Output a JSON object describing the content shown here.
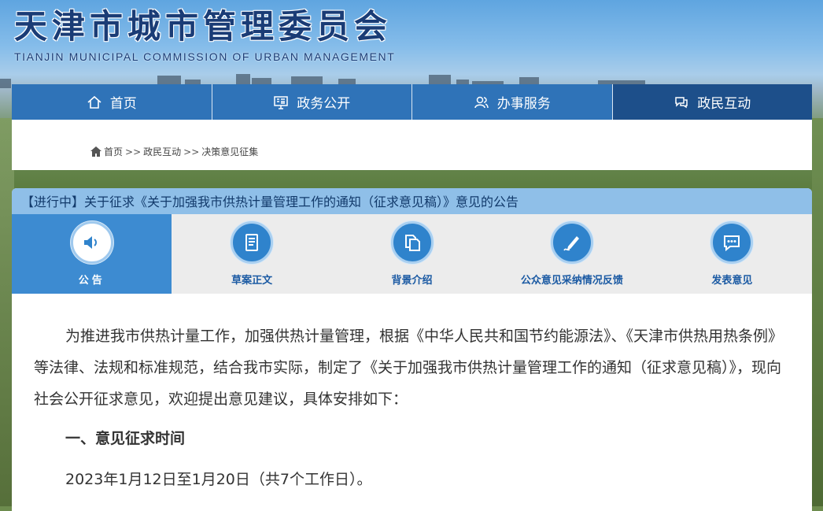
{
  "header": {
    "title": "天津市城市管理委员会",
    "subtitle": "TIANJIN MUNICIPAL COMMISSION OF URBAN MANAGEMENT"
  },
  "nav": {
    "items": [
      {
        "label": "首页",
        "icon": "home-outline-icon"
      },
      {
        "label": "政务公开",
        "icon": "monitor-doc-icon"
      },
      {
        "label": "办事服务",
        "icon": "people-icon"
      },
      {
        "label": "政民互动",
        "icon": "chat-bubbles-icon"
      }
    ]
  },
  "breadcrumb": {
    "home": "首页",
    "sep": ">>",
    "level1": "政民互动",
    "level2": "决策意见征集"
  },
  "notice": {
    "title": "【进行中】关于征求《关于加强我市供热计量管理工作的通知（征求意见稿）》意见的公告",
    "tabs": [
      {
        "label": "公告",
        "icon": "speaker-icon"
      },
      {
        "label": "草案正文",
        "icon": "document-icon"
      },
      {
        "label": "背景介绍",
        "icon": "copy-files-icon"
      },
      {
        "label": "公众意见采纳情况反馈",
        "icon": "pen-edit-icon"
      },
      {
        "label": "发表意见",
        "icon": "comment-icon"
      }
    ],
    "paragraph": "为推进我市供热计量工作，加强供热计量管理，根据《中华人民共和国节约能源法》、《天津市供热用热条例》等法律、法规和标准规范，结合我市实际，制定了《关于加强我市供热计量管理工作的通知（征求意见稿）》，现向社会公开征求意见，欢迎提出意见建议，具体安排如下：",
    "section1_title": "一、意见征求时间",
    "section1_body": "2023年1月12日至1月20日（共7个工作日）。"
  },
  "colors": {
    "nav": "#2f73b8",
    "nav_active": "#1d4f8a",
    "title_bar": "#8fbfe8",
    "tab_active": "#3d8bd1"
  }
}
